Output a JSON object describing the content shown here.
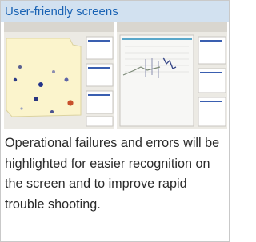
{
  "header": {
    "title": "User-friendly screens"
  },
  "screenshots": [
    {
      "name": "layout-view-screenshot"
    },
    {
      "name": "line-graph-screenshot"
    }
  ],
  "description": "Operational failures and errors will be highlighted for easier recognition on the screen and to improve rapid trouble shooting.",
  "colors": {
    "header_bg": "#d2e1f0",
    "title": "#1a63b4",
    "body_text": "#2a2a2a",
    "layout_map_fill": "#fbf4cc",
    "error_marker": "#c8502c",
    "normal_marker": "#22328a"
  }
}
